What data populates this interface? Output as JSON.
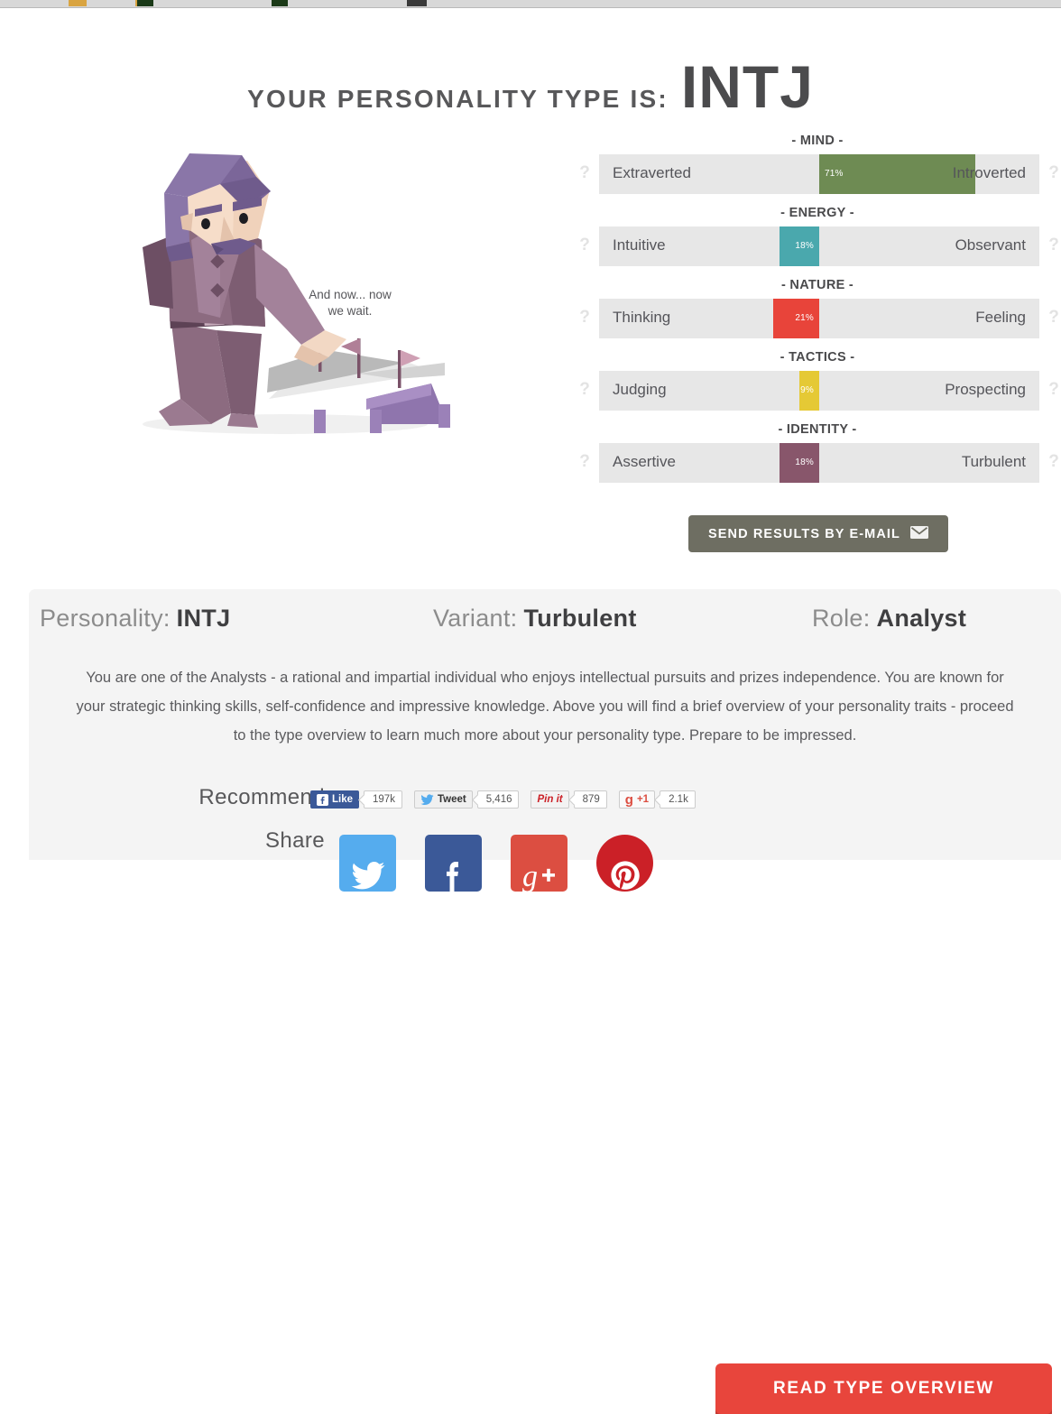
{
  "headline": {
    "lead": "Your personality type is:",
    "type": "INTJ"
  },
  "illustration": {
    "caption_line1": "And now... now",
    "caption_line2": "we wait.",
    "alt": "low-poly strategist with map and flags"
  },
  "traits": {
    "help_icon": "?",
    "groups": [
      {
        "heading": "- MIND -",
        "left": "Extraverted",
        "right": "Introverted",
        "percent": "71%",
        "value": 71,
        "side": "right",
        "color": "#6e8b53"
      },
      {
        "heading": "- ENERGY -",
        "left": "Intuitive",
        "right": "Observant",
        "percent": "18%",
        "value": 18,
        "side": "left",
        "color": "#4aa8ad"
      },
      {
        "heading": "- NATURE -",
        "left": "Thinking",
        "right": "Feeling",
        "percent": "21%",
        "value": 21,
        "side": "left",
        "color": "#e8443a"
      },
      {
        "heading": "- TACTICS -",
        "left": "Judging",
        "right": "Prospecting",
        "percent": "9%",
        "value": 9,
        "side": "left",
        "color": "#e5c935"
      },
      {
        "heading": "- IDENTITY -",
        "left": "Assertive",
        "right": "Turbulent",
        "percent": "18%",
        "value": 18,
        "side": "left",
        "color": "#88566b"
      }
    ]
  },
  "send_button": {
    "label": "Send results by e-mail",
    "icon": "envelope-icon"
  },
  "panel": {
    "meta": [
      {
        "key": "Personality:",
        "value": "INTJ"
      },
      {
        "key": "Variant:",
        "value": "Turbulent"
      },
      {
        "key": "Role:",
        "value": "Analyst"
      }
    ],
    "description": "You are one of the Analysts - a rational and impartial individual who enjoys intellectual pursuits and prizes independence. You are known for your strategic thinking skills, self-confidence and impressive knowledge. Above you will find a brief overview of your personality traits - proceed to the type overview to learn much more about your personality type. Prepare to be impressed.",
    "recommend_label": "Recommend",
    "share_label": "Share",
    "social_counts": [
      {
        "network": "facebook",
        "label": "Like",
        "count": "197k"
      },
      {
        "network": "twitter",
        "label": "Tweet",
        "count": "5,416"
      },
      {
        "network": "pinterest",
        "label": "Pin it",
        "count": "879"
      },
      {
        "network": "googleplus",
        "label": "+1",
        "count": "2.1k"
      }
    ],
    "share_icons": [
      {
        "network": "twitter-share-icon",
        "color": "#55acee"
      },
      {
        "network": "facebook-share-icon",
        "color": "#3b5998"
      },
      {
        "network": "googleplus-share-icon",
        "color": "#dc4e41"
      },
      {
        "network": "pinterest-share-icon",
        "color": "#cb2027"
      }
    ],
    "read_button": {
      "label": "Read type overview"
    }
  }
}
